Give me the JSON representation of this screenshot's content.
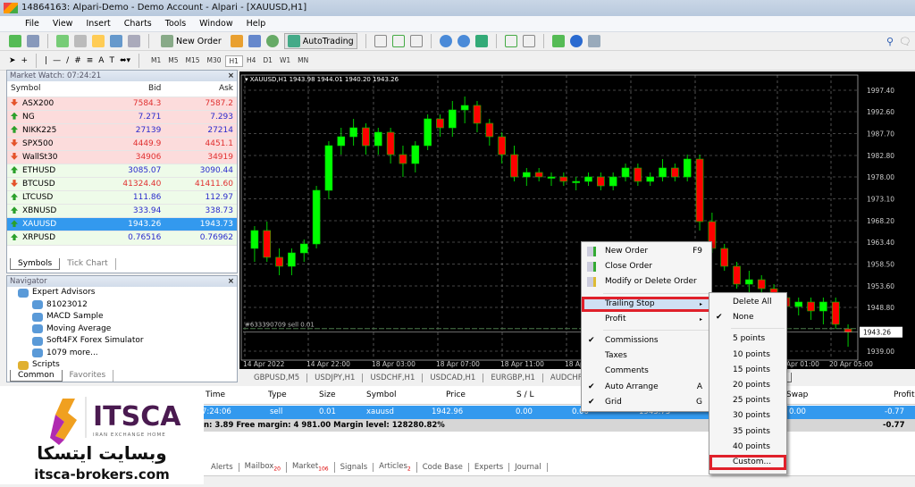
{
  "window": {
    "title": "14864163: Alpari-Demo - Demo Account - Alpari - [XAUUSD,H1]"
  },
  "menu": [
    "File",
    "View",
    "Insert",
    "Charts",
    "Tools",
    "Window",
    "Help"
  ],
  "toolbar": {
    "new_order": "New Order",
    "autotrading": "AutoTrading",
    "timeframes": [
      "M1",
      "M5",
      "M15",
      "M30",
      "H1",
      "H4",
      "D1",
      "W1",
      "MN"
    ],
    "active_tf": "H1"
  },
  "market_watch": {
    "title": "Market Watch: 07:24:21",
    "columns": [
      "Symbol",
      "Bid",
      "Ask"
    ],
    "rows": [
      {
        "symbol": "ASX200",
        "bid": "7584.3",
        "ask": "7587.2",
        "dir": "down",
        "bg": "red"
      },
      {
        "symbol": "NG",
        "bid": "7.271",
        "ask": "7.293",
        "dir": "up",
        "bg": "red"
      },
      {
        "symbol": "NIKK225",
        "bid": "27139",
        "ask": "27214",
        "dir": "up",
        "bg": "red"
      },
      {
        "symbol": "SPX500",
        "bid": "4449.9",
        "ask": "4451.1",
        "dir": "down",
        "bg": "red"
      },
      {
        "symbol": "WallSt30",
        "bid": "34906",
        "ask": "34919",
        "dir": "down",
        "bg": "red"
      },
      {
        "symbol": "ETHUSD",
        "bid": "3085.07",
        "ask": "3090.44",
        "dir": "up",
        "bg": "green"
      },
      {
        "symbol": "BTCUSD",
        "bid": "41324.40",
        "ask": "41411.60",
        "dir": "down",
        "bg": "green"
      },
      {
        "symbol": "LTCUSD",
        "bid": "111.86",
        "ask": "112.97",
        "dir": "up",
        "bg": "green"
      },
      {
        "symbol": "XBNUSD",
        "bid": "333.94",
        "ask": "338.73",
        "dir": "up",
        "bg": "green"
      },
      {
        "symbol": "XAUUSD",
        "bid": "1943.26",
        "ask": "1943.73",
        "dir": "up",
        "bg": "selected"
      },
      {
        "symbol": "XRPUSD",
        "bid": "0.76516",
        "ask": "0.76962",
        "dir": "up",
        "bg": "green"
      }
    ],
    "tabs": [
      "Symbols",
      "Tick Chart"
    ]
  },
  "navigator": {
    "title": "Navigator",
    "items": [
      {
        "label": "Expert Advisors",
        "level": 0
      },
      {
        "label": "81023012",
        "level": 1
      },
      {
        "label": "MACD Sample",
        "level": 1
      },
      {
        "label": "Moving Average",
        "level": 1
      },
      {
        "label": "Soft4FX Forex Simulator",
        "level": 1
      },
      {
        "label": "1079 more...",
        "level": 1
      },
      {
        "label": "Scripts",
        "level": 0
      }
    ],
    "tabs": [
      "Common",
      "Favorites"
    ]
  },
  "chart": {
    "header": "XAUUSD,H1  1943.98 1944.01 1940.20 1943.26",
    "order_line": "#633390709 sell 0.01",
    "current_price": "1943.26",
    "price_labels": [
      "1997.40",
      "1992.60",
      "1987.70",
      "1982.80",
      "1978.00",
      "1973.10",
      "1968.20",
      "1963.40",
      "1958.50",
      "1953.60",
      "1948.80",
      "1939.00"
    ],
    "time_labels": [
      "14 Apr 2022",
      "14 Apr 22:00",
      "18 Apr 03:00",
      "18 Apr 07:00",
      "18 Apr 11:00",
      "18 Apr 15:00",
      "18 Apr 19:00",
      "18 Apr 23:00",
      "20 Apr 01:00",
      "20 Apr 05:00"
    ],
    "up_color": "#00ff00",
    "down_color": "#ff0000",
    "candles": [
      [
        1962,
        1967,
        1959,
        1966
      ],
      [
        1966,
        1968,
        1959,
        1960
      ],
      [
        1960,
        1962,
        1956,
        1958
      ],
      [
        1958,
        1962,
        1956,
        1961
      ],
      [
        1961,
        1964,
        1959,
        1963
      ],
      [
        1963,
        1976,
        1962,
        1975
      ],
      [
        1975,
        1986,
        1973,
        1985
      ],
      [
        1985,
        1989,
        1983,
        1987
      ],
      [
        1987,
        1991,
        1985,
        1989
      ],
      [
        1989,
        1990,
        1983,
        1985
      ],
      [
        1985,
        1989,
        1983,
        1988
      ],
      [
        1988,
        1989,
        1981,
        1983
      ],
      [
        1983,
        1985,
        1978,
        1981
      ],
      [
        1981,
        1986,
        1979,
        1985
      ],
      [
        1985,
        1992,
        1984,
        1991
      ],
      [
        1991,
        1992,
        1987,
        1989
      ],
      [
        1989,
        1995,
        1987,
        1993
      ],
      [
        1993,
        1996,
        1990,
        1994
      ],
      [
        1994,
        1995,
        1988,
        1990
      ],
      [
        1990,
        1991,
        1985,
        1987
      ],
      [
        1987,
        1988,
        1981,
        1983
      ],
      [
        1983,
        1985,
        1977,
        1978
      ],
      [
        1978,
        1980,
        1976,
        1979
      ],
      [
        1979,
        1980,
        1977,
        1978
      ],
      [
        1978,
        1979,
        1976,
        1978
      ],
      [
        1978,
        1979,
        1976,
        1977
      ],
      [
        1977,
        1978,
        1975,
        1977
      ],
      [
        1977,
        1979,
        1976,
        1978
      ],
      [
        1978,
        1979,
        1975,
        1976
      ],
      [
        1976,
        1979,
        1975,
        1978
      ],
      [
        1978,
        1981,
        1977,
        1980
      ],
      [
        1980,
        1981,
        1976,
        1977
      ],
      [
        1977,
        1979,
        1976,
        1978
      ],
      [
        1978,
        1982,
        1977,
        1980
      ],
      [
        1980,
        1981,
        1977,
        1978
      ],
      [
        1978,
        1983,
        1977,
        1982
      ],
      [
        1982,
        1983,
        1966,
        1968
      ],
      [
        1968,
        1970,
        1961,
        1962
      ],
      [
        1962,
        1963,
        1957,
        1958
      ],
      [
        1958,
        1959,
        1953,
        1954
      ],
      [
        1954,
        1957,
        1952,
        1955
      ],
      [
        1955,
        1956,
        1951,
        1953
      ],
      [
        1953,
        1954,
        1949,
        1951
      ],
      [
        1951,
        1952,
        1947,
        1949
      ],
      [
        1949,
        1951,
        1947,
        1950
      ],
      [
        1950,
        1951,
        1946,
        1948
      ],
      [
        1948,
        1951,
        1945,
        1950
      ],
      [
        1950,
        1951,
        1944,
        1945
      ],
      [
        1944,
        1945,
        1940,
        1943.26
      ]
    ]
  },
  "chart_tabs": [
    "GBPUSD,M5",
    "USDJPY,H1",
    "USDCHF,H1",
    "USDCAD,H1",
    "EURGBP,H1",
    "AUDCHF,H1",
    "XAUUSD,H1"
  ],
  "terminal": {
    "columns": {
      "time": "Time",
      "type": "Type",
      "size": "Size",
      "symbol": "Symbol",
      "price": "Price",
      "sl": "S / L",
      "swap": "Swap",
      "profit": "Profit"
    },
    "row": {
      "time": "7:24:06",
      "type": "sell",
      "size": "0.01",
      "symbol": "xauusd",
      "price": "1942.96",
      "sl": "0.00",
      "tp": "0.00",
      "cur_price": "1943.73",
      "swap": "0.00",
      "profit": "-0.77"
    },
    "summary": "n: 3.89  Free margin: 4 981.00  Margin level: 128280.82%",
    "summary_profit": "-0.77",
    "tabs": [
      {
        "label": "Alerts"
      },
      {
        "label": "Mailbox",
        "badge": "20"
      },
      {
        "label": "Market",
        "badge": "106"
      },
      {
        "label": "Signals"
      },
      {
        "label": "Articles",
        "badge": "2"
      },
      {
        "label": "Code Base"
      },
      {
        "label": "Experts"
      },
      {
        "label": "Journal"
      }
    ]
  },
  "context_menu": {
    "items": [
      {
        "label": "New Order",
        "shortcut": "F9"
      },
      {
        "label": "Close Order"
      },
      {
        "label": "Modify or Delete Order"
      },
      {
        "label": "Trailing Stop",
        "submenu": true,
        "highlighted": true
      },
      {
        "label": "Profit",
        "submenu": true
      },
      {
        "label": "Commissions",
        "checked": true
      },
      {
        "label": "Taxes"
      },
      {
        "label": "Comments"
      },
      {
        "label": "Auto Arrange",
        "checked": true,
        "shortcut": "A"
      },
      {
        "label": "Grid",
        "checked": true,
        "shortcut": "G"
      }
    ]
  },
  "submenu": {
    "items": [
      {
        "label": "Delete All"
      },
      {
        "label": "None",
        "checked": true
      },
      {
        "label": "5 points"
      },
      {
        "label": "10 points"
      },
      {
        "label": "15 points"
      },
      {
        "label": "20 points"
      },
      {
        "label": "25 points"
      },
      {
        "label": "30 points"
      },
      {
        "label": "35 points"
      },
      {
        "label": "40 points"
      },
      {
        "label": "Custom...",
        "highlighted": true
      }
    ]
  },
  "logo": {
    "brand": "ITSCA",
    "tagline": "IRAN EXCHANGE HOME",
    "persian": "وبسایت ایتسکا",
    "url": "itsca-brokers.com"
  },
  "colors": {
    "selection": "#3399ee",
    "highlight_box": "#e0202a"
  }
}
